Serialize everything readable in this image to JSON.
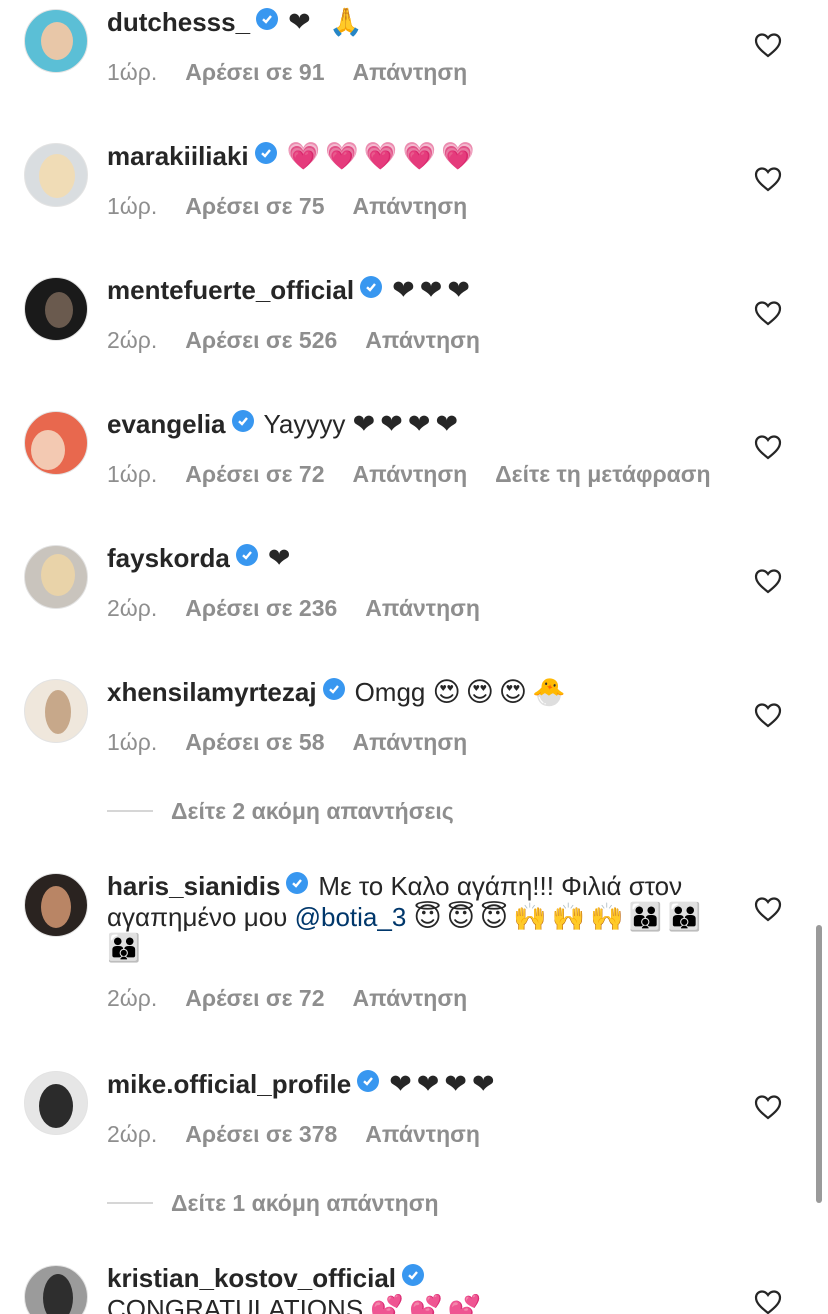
{
  "comments": [
    {
      "username": "dutchesss_",
      "text": "",
      "emoji": "❤ 🙏",
      "time": "1ώρ.",
      "likes": "Αρέσει σε 91",
      "reply": "Απάντηση",
      "avatar_bg": "#5bbfd6",
      "avatar_fg": "#e8c7a8"
    },
    {
      "username": "marakiiliaki",
      "text": "",
      "emoji": "💗💗💗💗💗",
      "time": "1ώρ.",
      "likes": "Αρέσει σε 75",
      "reply": "Απάντηση",
      "avatar_bg": "#d9dde0",
      "avatar_fg": "#f0dcb6"
    },
    {
      "username": "mentefuerte_official",
      "text": "",
      "emoji": "❤❤❤",
      "time": "2ώρ.",
      "likes": "Αρέσει σε 526",
      "reply": "Απάντηση",
      "avatar_bg": "#1a1a1a",
      "avatar_fg": "#6a5a4e"
    },
    {
      "username": "evangelia",
      "text": "Yayyyy",
      "emoji": "❤❤❤❤",
      "time": "1ώρ.",
      "likes": "Αρέσει σε 72",
      "reply": "Απάντηση",
      "translate": "Δείτε τη μετάφραση",
      "avatar_bg": "#e8684e",
      "avatar_fg": "#f3c9b2"
    },
    {
      "username": "fayskorda",
      "text": "",
      "emoji": "❤",
      "time": "2ώρ.",
      "likes": "Αρέσει σε 236",
      "reply": "Απάντηση",
      "avatar_bg": "#c9c4bd",
      "avatar_fg": "#e9d3a9"
    },
    {
      "username": "xhensilamyrtezaj",
      "text": "Omgg",
      "emoji": "😍😍😍🐣",
      "time": "1ώρ.",
      "likes": "Αρέσει σε 58",
      "reply": "Απάντηση",
      "avatar_bg": "#efe7dc",
      "avatar_fg": "#c7a88a"
    },
    {
      "username": "haris_sianidis",
      "text": "Με το Καλο αγάπη!!! Φιλιά στον αγαπημένο μου",
      "mention": "@botia_3",
      "emoji": "😇😇😇🙌🙌🙌👪👪👪",
      "time": "2ώρ.",
      "likes": "Αρέσει σε 72",
      "reply": "Απάντηση",
      "avatar_bg": "#2a2320",
      "avatar_fg": "#b98565"
    },
    {
      "username": "mike.official_profile",
      "text": "",
      "emoji": "❤❤❤❤",
      "time": "2ώρ.",
      "likes": "Αρέσει σε 378",
      "reply": "Απάντηση",
      "avatar_bg": "#e6e6e6",
      "avatar_fg": "#2b2b2b"
    },
    {
      "username": "kristian_kostov_official",
      "text": "CONGRATULATIONS",
      "emoji": "💕💕💕",
      "avatar_bg": "#9b9b9b",
      "avatar_fg": "#2e2e2e"
    }
  ],
  "more_replies": [
    "Δείτε 2 ακόμη απαντήσεις",
    "Δείτε 1 ακόμη απάντηση"
  ],
  "colors": {
    "verified": "#3897f0",
    "mention": "#00376b",
    "meta": "#8e8e8e"
  },
  "icons": {
    "like": "heart-outline-icon",
    "verified": "verified-badge-icon"
  }
}
